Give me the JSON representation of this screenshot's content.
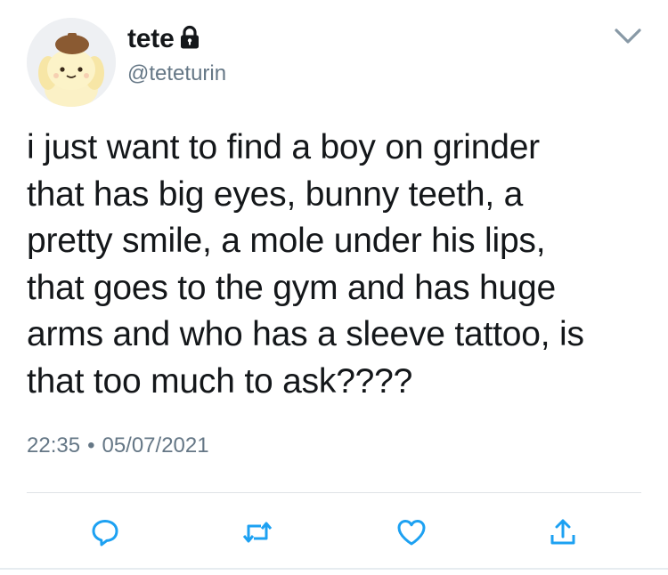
{
  "tweet": {
    "display_name": "tete",
    "handle": "@teteturin",
    "text_lines": [
      "i just want to find a boy on grinder",
      "that has big eyes, bunny teeth, a",
      "pretty smile, a mole under his lips,",
      "that goes to the gym and has huge",
      "arms and who has a sleeve tattoo, is",
      "that too much to ask????"
    ],
    "time": "22:35",
    "separator": "•",
    "date": "05/07/2021"
  },
  "icons": {
    "lock": "lock-icon",
    "chevron": "chevron-down-icon",
    "reply": "reply-icon",
    "retweet": "retweet-icon",
    "like": "heart-icon",
    "share": "share-icon"
  },
  "colors": {
    "text": "#14171a",
    "secondary": "#657786",
    "icon": "#1da1f2"
  }
}
